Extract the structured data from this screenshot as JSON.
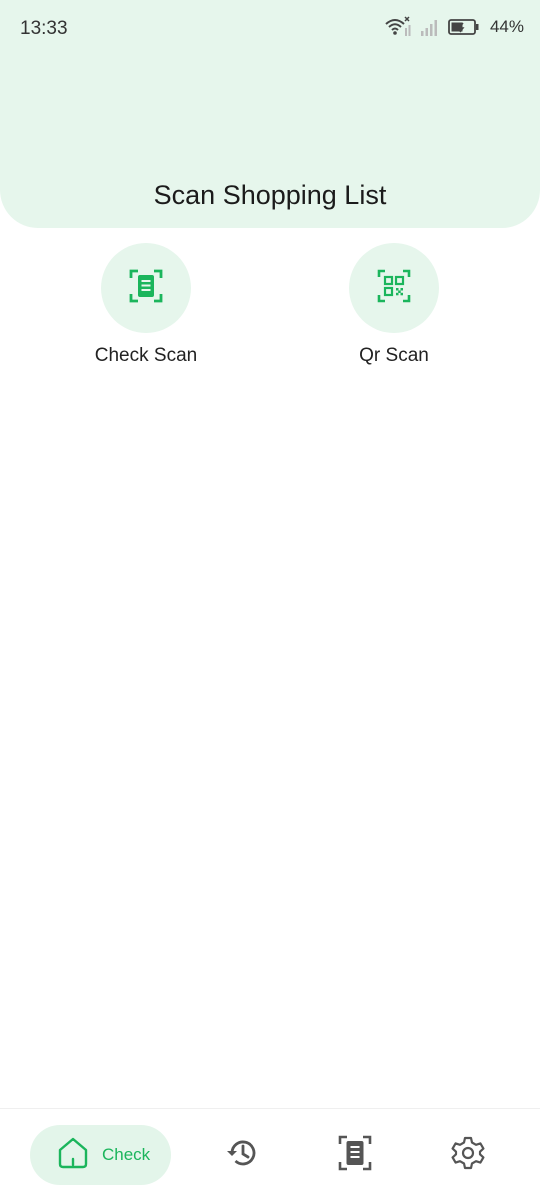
{
  "status_bar": {
    "time": "13:33",
    "battery": "44%",
    "icons": [
      "wifi-icon",
      "mobile-signal-icon",
      "mobile-signal-icon",
      "battery-icon"
    ]
  },
  "header": {
    "title": "Scan Shopping List"
  },
  "actions": [
    {
      "label": "Check Scan",
      "icon": "document-scan-icon"
    },
    {
      "label": "Qr Scan",
      "icon": "qr-code-icon"
    }
  ],
  "bottom_nav": {
    "items": [
      {
        "label": "Check",
        "icon": "home-icon",
        "active": true
      },
      {
        "label": "",
        "icon": "history-icon",
        "active": false
      },
      {
        "label": "",
        "icon": "document-scan-icon",
        "active": false
      },
      {
        "label": "",
        "icon": "gear-icon",
        "active": false
      }
    ]
  },
  "colors": {
    "accent": "#1bb55c",
    "header_bg": "#e6f6ec",
    "nav_icon": "#555555"
  }
}
